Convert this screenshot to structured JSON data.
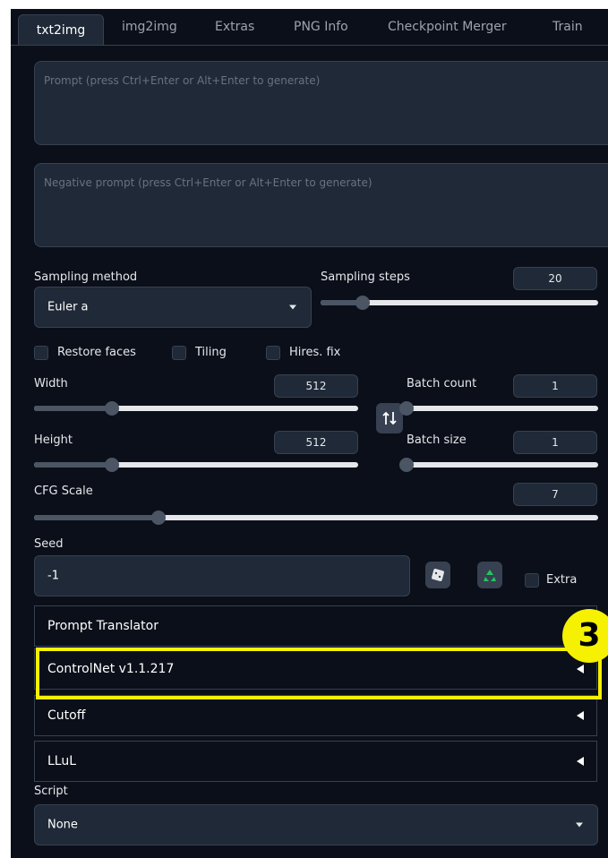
{
  "tabs": [
    {
      "label": "txt2img",
      "active": true
    },
    {
      "label": "img2img"
    },
    {
      "label": "Extras"
    },
    {
      "label": "PNG Info"
    },
    {
      "label": "Checkpoint Merger"
    },
    {
      "label": "Train"
    }
  ],
  "prompt": {
    "placeholder": "Prompt (press Ctrl+Enter or Alt+Enter to generate)"
  },
  "negative_prompt": {
    "placeholder": "Negative prompt (press Ctrl+Enter or Alt+Enter to generate)"
  },
  "sampling": {
    "method_label": "Sampling method",
    "method_value": "Euler a",
    "steps_label": "Sampling steps",
    "steps_value": "20",
    "steps_fraction": 0.15
  },
  "options": {
    "restore_faces": "Restore faces",
    "tiling": "Tiling",
    "hires_fix": "Hires. fix"
  },
  "width": {
    "label": "Width",
    "value": "512",
    "fraction": 0.24
  },
  "height": {
    "label": "Height",
    "value": "512",
    "fraction": 0.24
  },
  "batch_count": {
    "label": "Batch count",
    "value": "1",
    "fraction": 0.0
  },
  "batch_size": {
    "label": "Batch size",
    "value": "1",
    "fraction": 0.0
  },
  "cfg": {
    "label": "CFG Scale",
    "value": "7",
    "fraction": 0.22
  },
  "seed": {
    "label": "Seed",
    "value": "-1",
    "extra_label": "Extra"
  },
  "accordions": [
    {
      "label": "Prompt Translator"
    },
    {
      "label": "ControlNet v1.1.217"
    },
    {
      "label": "Cutoff"
    },
    {
      "label": "LLuL"
    }
  ],
  "script": {
    "label": "Script",
    "value": "None"
  },
  "annotation": {
    "number": "3"
  },
  "colors": {
    "highlight": "#f5f100",
    "background": "#0b0f19",
    "panel": "#1f2937"
  },
  "icons": {
    "swap": "swap-vertical-icon",
    "dice": "dice-icon",
    "recycle": "recycle-icon"
  }
}
